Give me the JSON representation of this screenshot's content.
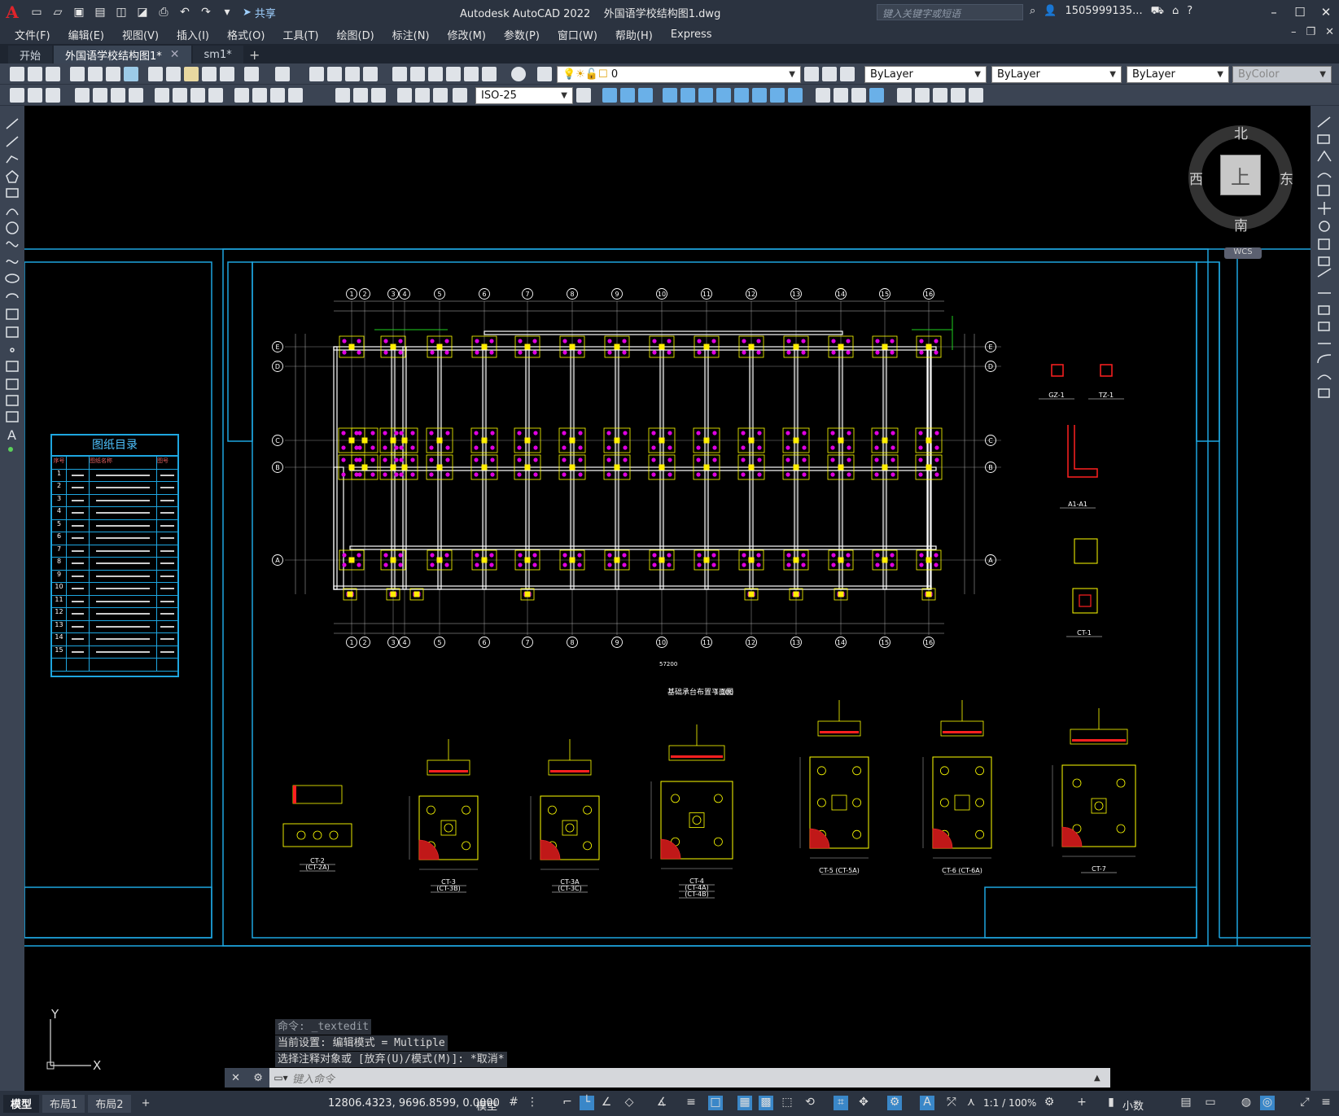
{
  "window": {
    "app_title": "Autodesk AutoCAD 2022",
    "file_name": "外国语学校结构图1.dwg",
    "share_label": "共享",
    "search_placeholder": "键入关键字或短语",
    "user_name": "1505999135..."
  },
  "menu": [
    "文件(F)",
    "编辑(E)",
    "视图(V)",
    "插入(I)",
    "格式(O)",
    "工具(T)",
    "绘图(D)",
    "标注(N)",
    "修改(M)",
    "参数(P)",
    "窗口(W)",
    "帮助(H)",
    "Express"
  ],
  "tabs": [
    {
      "label": "开始",
      "active": false,
      "closable": false
    },
    {
      "label": "外国语学校结构图1*",
      "active": true,
      "closable": true
    },
    {
      "label": "sm1*",
      "active": false,
      "closable": false
    }
  ],
  "properties": {
    "layer_value": "0",
    "color_value": "ByLayer",
    "linetype_value": "ByLayer",
    "lineweight_value": "ByLayer",
    "plotstyle_value": "ByColor",
    "dimstyle_value": "ISO-25"
  },
  "viewcube": {
    "north": "北",
    "south": "南",
    "east": "东",
    "west": "西",
    "top_face": "上",
    "wcs": "WCS"
  },
  "drawing": {
    "index_title": "图纸目录",
    "index_headers": [
      "序号",
      "图纸名称",
      "图号"
    ],
    "index_numbers": [
      "1",
      "2",
      "3",
      "4",
      "5",
      "6",
      "7",
      "8",
      "9",
      "10",
      "11",
      "12",
      "13",
      "14",
      "15"
    ],
    "grid_top_labels": [
      "1",
      "2",
      "3",
      "4",
      "5",
      "6",
      "7",
      "8",
      "9",
      "10",
      "11",
      "12",
      "13",
      "14",
      "15",
      "16"
    ],
    "grid_side_labels": [
      "E",
      "D",
      "C",
      "B",
      "A"
    ],
    "plan_title": "基础承台布置平面图",
    "plan_scale": "1:100",
    "total_dim": "57200",
    "detail_labels": [
      "GZ-1",
      "TZ-1",
      "A1-A1",
      "CT-1",
      "CT-2",
      "(CT-2A)",
      "CT-3",
      "(CT-3B)",
      "CT-3A",
      "(CT-3C)",
      "CT-4",
      "(CT-4A)",
      "(CT-4B)",
      "CT-5 (CT-5A)",
      "CT-6 (CT-6A)",
      "CT-7"
    ]
  },
  "command": {
    "history": [
      "命令: _textedit",
      "当前设置: 编辑模式 = Multiple",
      "选择注释对象或 [放弃(U)/模式(M)]: *取消*"
    ],
    "input_placeholder": "键入命令"
  },
  "status": {
    "layout_tabs": [
      "模型",
      "布局1",
      "布局2"
    ],
    "coordinates": "12806.4323, 9696.8599, 0.0000",
    "space": "模型",
    "scale": "1:1 / 100%",
    "units": "小数"
  },
  "ucs": {
    "x": "X",
    "y": "Y"
  },
  "colors": {
    "frame": "#1ea6e0",
    "wall": "#ffffff",
    "pile": "#e000e0",
    "column": "#ffee00",
    "highlight": "#ff2020",
    "pad": "#ffff00"
  }
}
